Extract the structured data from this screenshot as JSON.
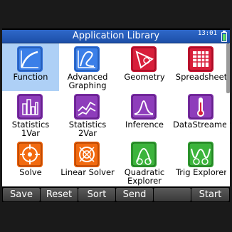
{
  "header": {
    "title": "Application Library",
    "clock": "13:01"
  },
  "apps": [
    {
      "label": "Function",
      "selected": true,
      "icon": "function-icon",
      "color": "#2f6dd6"
    },
    {
      "label": "Advanced Graphing",
      "selected": false,
      "icon": "advanced-graphing-icon",
      "color": "#2f6dd6"
    },
    {
      "label": "Geometry",
      "selected": false,
      "icon": "geometry-icon",
      "color": "#c8102e"
    },
    {
      "label": "Spreadsheet",
      "selected": false,
      "icon": "spreadsheet-icon",
      "color": "#c8102e"
    },
    {
      "label": "Statistics 1Var",
      "selected": false,
      "icon": "statistics-1var-icon",
      "color": "#7d2ea8"
    },
    {
      "label": "Statistics 2Var",
      "selected": false,
      "icon": "statistics-2var-icon",
      "color": "#7d2ea8"
    },
    {
      "label": "Inference",
      "selected": false,
      "icon": "inference-icon",
      "color": "#7d2ea8"
    },
    {
      "label": "DataStreamer",
      "selected": false,
      "icon": "datastreamer-icon",
      "color": "#7d2ea8"
    },
    {
      "label": "Solve",
      "selected": false,
      "icon": "solve-icon",
      "color": "#e85d04"
    },
    {
      "label": "Linear Solver",
      "selected": false,
      "icon": "linear-solver-icon",
      "color": "#e85d04"
    },
    {
      "label": "Quadratic Explorer",
      "selected": false,
      "icon": "quadratic-explorer-icon",
      "color": "#2f9e2f"
    },
    {
      "label": "Trig Explorer",
      "selected": false,
      "icon": "trig-explorer-icon",
      "color": "#2f9e2f"
    }
  ],
  "softkeys": [
    "Save",
    "Reset",
    "Sort",
    "Send",
    "",
    "Start"
  ]
}
